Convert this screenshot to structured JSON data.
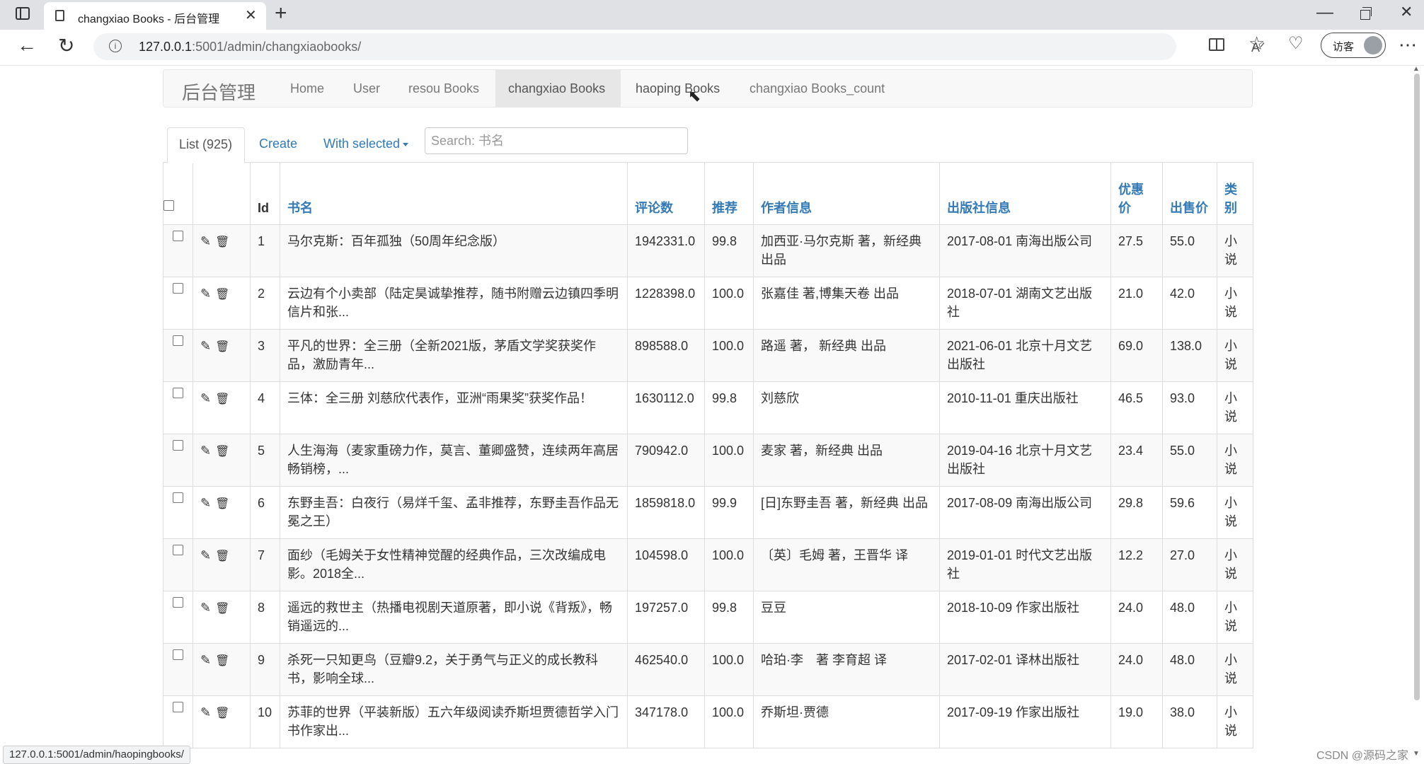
{
  "browser": {
    "tab_title": "changxiao Books - 后台管理",
    "url_host": "127.0.0.1",
    "url_path": ":5001/admin/changxiaobooks/",
    "guest_label": "访客",
    "status_url": "127.0.0.1:5001/admin/haopingbooks/"
  },
  "navbar": {
    "brand": "后台管理",
    "items": [
      "Home",
      "User",
      "resou Books",
      "changxiao Books",
      "haoping Books",
      "changxiao Books_count"
    ],
    "active_index": 3
  },
  "toolbar": {
    "list_label": "List (925)",
    "create_label": "Create",
    "with_selected_label": "With selected",
    "search_placeholder": "Search: 书名"
  },
  "table": {
    "columns": [
      "Id",
      "书名",
      "评论数",
      "推荐",
      "作者信息",
      "出版社信息",
      "优惠价",
      "出售价",
      "类别"
    ],
    "rows": [
      {
        "id": "1",
        "title": "马尔克斯：百年孤独（50周年纪念版）",
        "comments": "1942331.0",
        "recommend": "99.8",
        "author": "加西亚·马尔克斯 著，新经典 出品",
        "publisher": "2017-08-01 南海出版公司",
        "discount": "27.5",
        "price": "55.0",
        "category": "小说"
      },
      {
        "id": "2",
        "title": "云边有个小卖部（陆定昊诚挚推荐，随书附赠云边镇四季明信片和张...",
        "comments": "1228398.0",
        "recommend": "100.0",
        "author": "张嘉佳 著,博集天卷 出品",
        "publisher": "2018-07-01 湖南文艺出版社",
        "discount": "21.0",
        "price": "42.0",
        "category": "小说"
      },
      {
        "id": "3",
        "title": "平凡的世界：全三册（全新2021版，茅盾文学奖获奖作品，激励青年...",
        "comments": "898588.0",
        "recommend": "100.0",
        "author": "路遥 著， 新经典 出品",
        "publisher": "2021-06-01 北京十月文艺出版社",
        "discount": "69.0",
        "price": "138.0",
        "category": "小说"
      },
      {
        "id": "4",
        "title": "三体：全三册 刘慈欣代表作，亚洲“雨果奖”获奖作品！",
        "comments": "1630112.0",
        "recommend": "99.8",
        "author": "刘慈欣",
        "publisher": "2010-11-01 重庆出版社",
        "discount": "46.5",
        "price": "93.0",
        "category": "小说"
      },
      {
        "id": "5",
        "title": "人生海海（麦家重磅力作，莫言、董卿盛赞，连续两年高居畅销榜，...",
        "comments": "790942.0",
        "recommend": "100.0",
        "author": "麦家 著，新经典 出品",
        "publisher": "2019-04-16 北京十月文艺出版社",
        "discount": "23.4",
        "price": "55.0",
        "category": "小说"
      },
      {
        "id": "6",
        "title": "东野圭吾：白夜行（易烊千玺、孟非推荐，东野圭吾作品无冕之王）",
        "comments": "1859818.0",
        "recommend": "99.9",
        "author": "[日]东野圭吾 著，新经典 出品",
        "publisher": "2017-08-09 南海出版公司",
        "discount": "29.8",
        "price": "59.6",
        "category": "小说"
      },
      {
        "id": "7",
        "title": "面纱（毛姆关于女性精神觉醒的经典作品，三次改编成电影。2018全...",
        "comments": "104598.0",
        "recommend": "100.0",
        "author": "〔英〕毛姆 著，王晋华 译",
        "publisher": "2019-01-01 时代文艺出版社",
        "discount": "12.2",
        "price": "27.0",
        "category": "小说"
      },
      {
        "id": "8",
        "title": "遥远的救世主（热播电视剧天道原著，即小说《背叛》，畅销遥远的...",
        "comments": "197257.0",
        "recommend": "99.8",
        "author": "豆豆",
        "publisher": "2018-10-09 作家出版社",
        "discount": "24.0",
        "price": "48.0",
        "category": "小说"
      },
      {
        "id": "9",
        "title": "杀死一只知更鸟（豆瓣9.2，关于勇气与正义的成长教科书，影响全球...",
        "comments": "462540.0",
        "recommend": "100.0",
        "author": "哈珀·李　著 李育超 译",
        "publisher": "2017-02-01 译林出版社",
        "discount": "24.0",
        "price": "48.0",
        "category": "小说"
      },
      {
        "id": "10",
        "title": "苏菲的世界（平装新版）五六年级阅读乔斯坦贾德哲学入门书作家出...",
        "comments": "347178.0",
        "recommend": "100.0",
        "author": "乔斯坦·贾德",
        "publisher": "2017-09-19 作家出版社",
        "discount": "19.0",
        "price": "38.0",
        "category": "小说"
      }
    ]
  },
  "watermark": "CSDN @源码之家",
  "colors": {
    "link": "#337ab7",
    "navbar_bg": "#f8f8f8",
    "active_nav_bg": "#e7e7e7"
  }
}
